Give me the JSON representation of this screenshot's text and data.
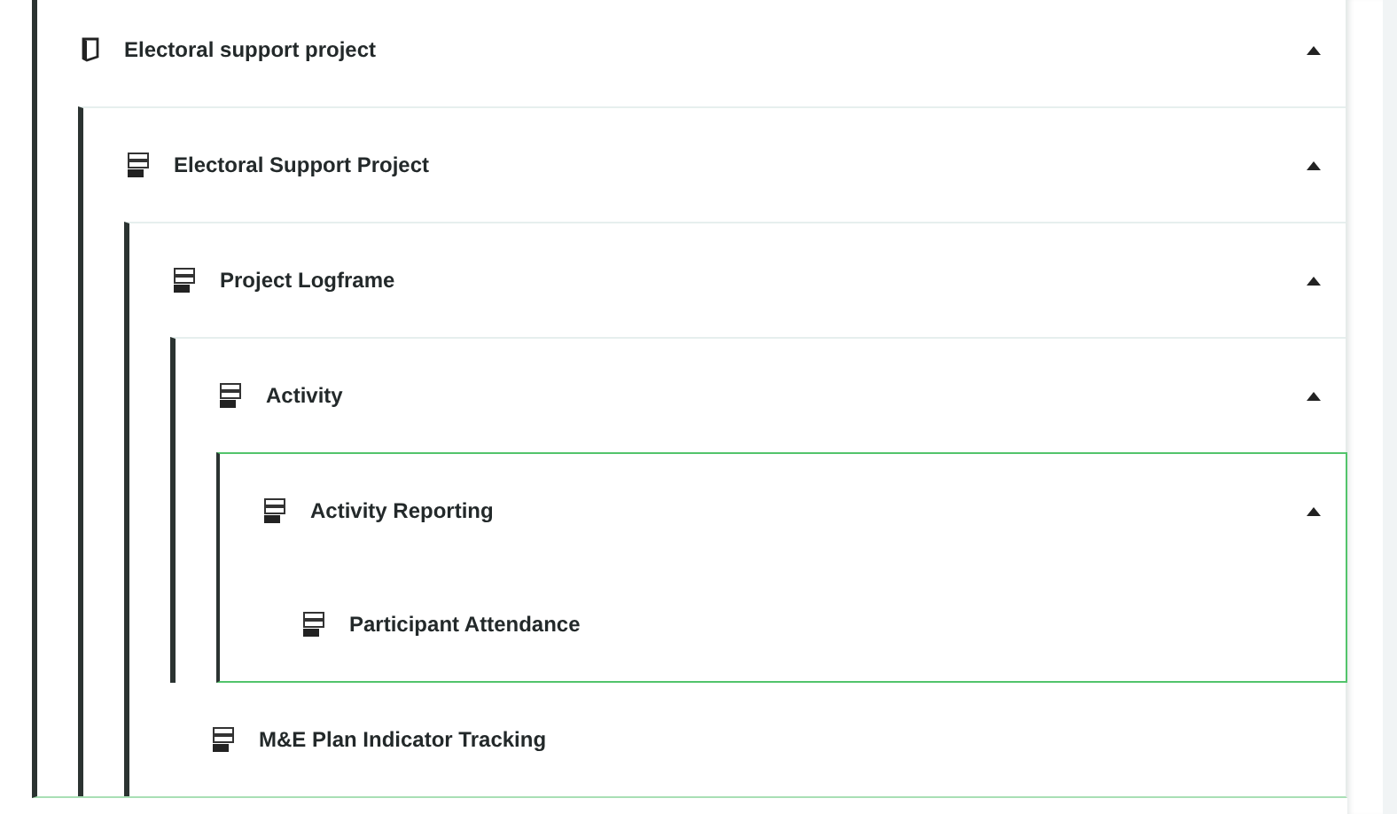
{
  "tree": [
    {
      "label": "Electoral support project",
      "kind": "document",
      "expanded": true,
      "selected": false,
      "children": [
        {
          "label": "Electoral Support Project",
          "kind": "stack",
          "expanded": true,
          "selected": false,
          "children": [
            {
              "label": "Project Logframe",
              "kind": "stack",
              "expanded": true,
              "selected": false,
              "children": [
                {
                  "label": "Activity",
                  "kind": "stack",
                  "expanded": true,
                  "selected": false,
                  "children": [
                    {
                      "label": "Activity Reporting",
                      "kind": "stack",
                      "expanded": true,
                      "selected": true,
                      "children": [
                        {
                          "label": "Participant Attendance",
                          "kind": "stack",
                          "selected": false
                        }
                      ]
                    }
                  ]
                },
                {
                  "label": "M&E Plan Indicator Tracking",
                  "kind": "stack",
                  "selected": false
                }
              ]
            }
          ]
        }
      ]
    }
  ]
}
